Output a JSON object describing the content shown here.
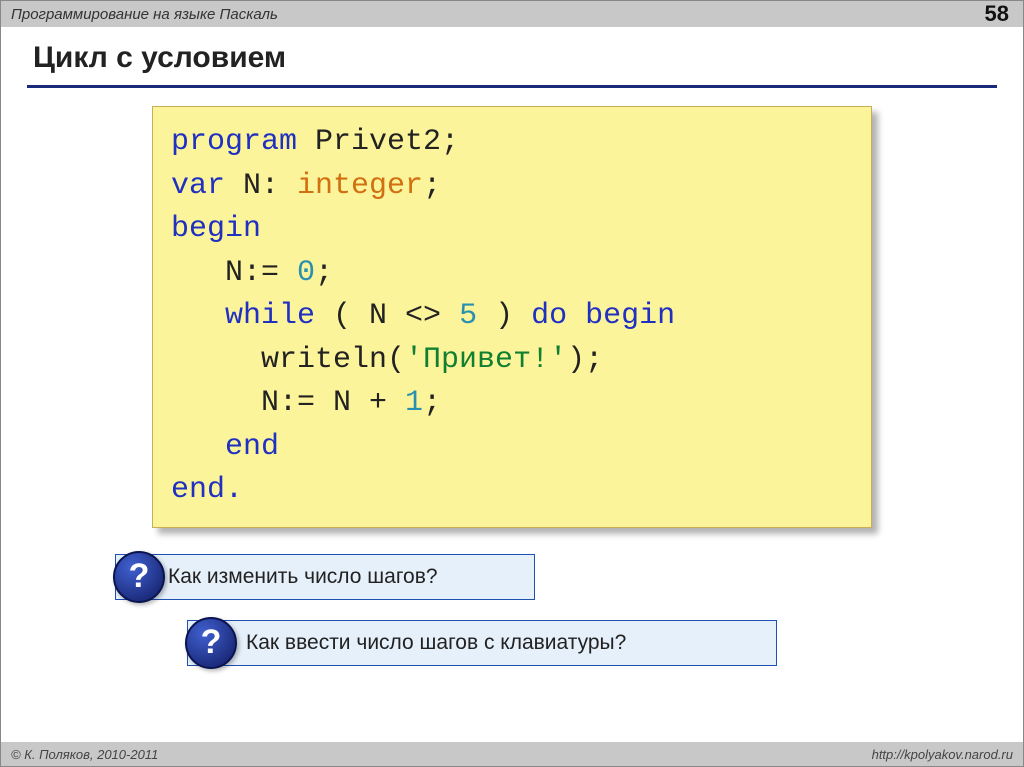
{
  "header": {
    "title": "Программирование на языке Паскаль",
    "page_number": "58"
  },
  "slide": {
    "title": "Цикл с условием"
  },
  "code": {
    "l1_kw": "program",
    "l1_rest": " Privet2;",
    "l2_kw": "var",
    "l2_mid": " N: ",
    "l2_ty": "integer",
    "l2_end": ";",
    "l3_kw": "begin",
    "l4_a": "   N:= ",
    "l4_num": "0",
    "l4_b": ";",
    "l5_a": "   ",
    "l5_kw1": "while",
    "l5_b": " ( N <> ",
    "l5_num": "5",
    "l5_c": " ) ",
    "l5_kw2": "do begin",
    "l6_a": "     writeln(",
    "l6_str": "'Привет!'",
    "l6_b": ");",
    "l7_a": "     N:= N + ",
    "l7_num": "1",
    "l7_b": ";",
    "l8_a": "   ",
    "l8_kw": "end",
    "l9_kw": "end",
    "l9_dot": "."
  },
  "questions": {
    "icon": "?",
    "q1": "Как изменить число шагов?",
    "q2": "Как ввести число шагов с клавиатуры?"
  },
  "footer": {
    "left": "© К. Поляков, 2010-2011",
    "right": "http://kpolyakov.narod.ru"
  }
}
